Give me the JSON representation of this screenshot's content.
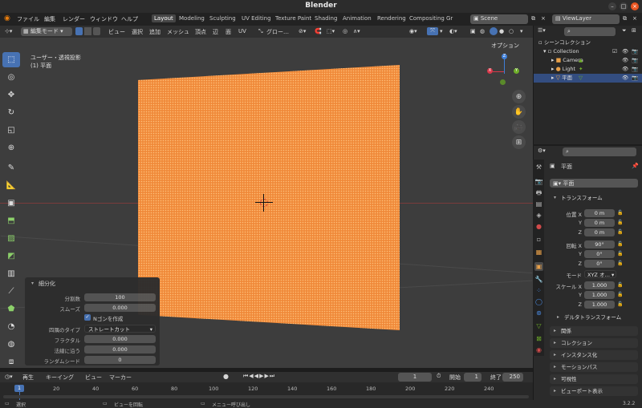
{
  "window": {
    "title": "Blender"
  },
  "top_menu": [
    "ファイル",
    "編集",
    "レンダー",
    "ウィンドウ",
    "ヘルプ"
  ],
  "workspaces": [
    {
      "label": "Layout",
      "active": true
    },
    {
      "label": "Modeling",
      "active": false
    },
    {
      "label": "Sculpting",
      "active": false
    },
    {
      "label": "UV Editing",
      "active": false
    },
    {
      "label": "Texture Paint",
      "active": false
    },
    {
      "label": "Shading",
      "active": false
    },
    {
      "label": "Animation",
      "active": false
    },
    {
      "label": "Rendering",
      "active": false
    },
    {
      "label": "Compositing",
      "active": false
    },
    {
      "label": "Gr",
      "active": false
    }
  ],
  "scene": {
    "name": "Scene"
  },
  "view_layer": {
    "name": "ViewLayer"
  },
  "header3d": {
    "mode": "編集モード",
    "menus": [
      "ビュー",
      "選択",
      "追加",
      "メッシュ",
      "頂点",
      "辺",
      "面",
      "UV"
    ],
    "orientation": "グロー…",
    "options": "オプション",
    "axes": [
      "X",
      "Y",
      "Z"
    ]
  },
  "viewport": {
    "view_name": "ユーザー・透視投影",
    "object_name": "(1) 平面",
    "plane_color": "#f08a3a"
  },
  "operator_panel": {
    "title": "細分化",
    "fields": [
      {
        "label": "分割数",
        "value": "100"
      },
      {
        "label": "スムーズ",
        "value": "0.000"
      }
    ],
    "ngon_label": "Nゴンを作成",
    "ngon_checked": true,
    "corner_label": "四隅のタイプ",
    "corner_value": "ストレートカット",
    "fields2": [
      {
        "label": "フラクタル",
        "value": "0.000"
      },
      {
        "label": "法線に沿う",
        "value": "0.000"
      },
      {
        "label": "ランダムシード",
        "value": "0"
      }
    ]
  },
  "timeline": {
    "menus": [
      "再生",
      "キーイング",
      "ビュー",
      "マーカー"
    ],
    "current_frame": "1",
    "start_label": "開始",
    "start": "1",
    "end_label": "終了",
    "end": "250",
    "ruler": [
      "1",
      "20",
      "40",
      "60",
      "80",
      "100",
      "120",
      "140",
      "160",
      "180",
      "200",
      "220",
      "240"
    ]
  },
  "status_bar": {
    "select": "選択",
    "rotate": "ビューを回転",
    "menu": "メニュー呼び出し",
    "version": "3.2.2"
  },
  "outliner": {
    "root": "シーンコレクション",
    "collection": "Collection",
    "items": [
      {
        "label": "Camera",
        "icon": "camera-icon"
      },
      {
        "label": "Light",
        "icon": "light-icon"
      },
      {
        "label": "平面",
        "icon": "mesh-icon"
      }
    ]
  },
  "properties": {
    "object_name": "平面",
    "object_field": "平面",
    "transform_title": "トランスフォーム",
    "location_label": "位置 X",
    "location": [
      "0 m",
      "0 m",
      "0 m"
    ],
    "rotation_label": "回転 X",
    "rotation": [
      "90°",
      "0°",
      "0°"
    ],
    "axis_y": "Y",
    "axis_z": "Z",
    "mode_label": "モード",
    "mode_value": "XYZ オ…",
    "scale_label": "スケール X",
    "scale": [
      "1.000",
      "1.000",
      "1.000"
    ],
    "delta_title": "デルタトランスフォーム",
    "sections": [
      "関係",
      "コレクション",
      "インスタンス化",
      "モーションパス",
      "可視性",
      "ビューポート表示"
    ]
  }
}
